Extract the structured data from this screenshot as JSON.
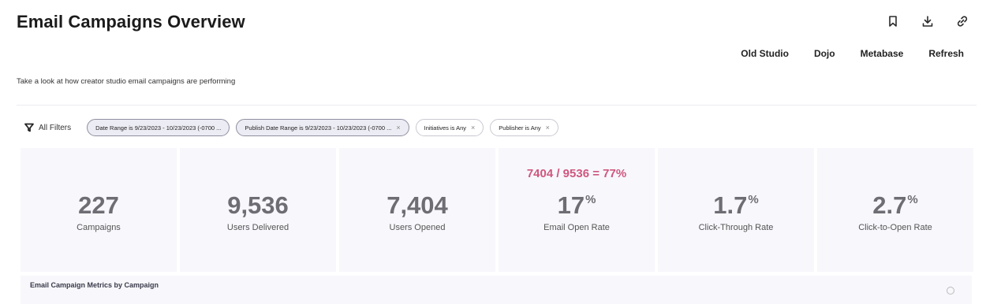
{
  "header": {
    "title": "Email Campaigns Overview",
    "subtitle": "Take a look at how creator studio email campaigns are performing",
    "icons": [
      "bookmark-icon",
      "download-icon",
      "link-icon"
    ],
    "nav_links": [
      "Old Studio",
      "Dojo",
      "Metabase",
      "Refresh"
    ]
  },
  "filters": {
    "all_filters_label": "All Filters",
    "chips": [
      {
        "label": "Date Range is 9/23/2023 - 10/23/2023 (-0700 ...",
        "removable": false,
        "active": true
      },
      {
        "label": "Publish Date Range is 9/23/2023 - 10/23/2023 (-0700 ...",
        "removable": true,
        "active": true
      },
      {
        "label": "Initiatives is Any",
        "removable": true,
        "active": false
      },
      {
        "label": "Publisher is Any",
        "removable": true,
        "active": false
      }
    ],
    "remove_glyph": "×"
  },
  "metrics": [
    {
      "value": "227",
      "suffix": "",
      "label": "Campaigns",
      "annotation": ""
    },
    {
      "value": "9,536",
      "suffix": "",
      "label": "Users Delivered",
      "annotation": ""
    },
    {
      "value": "7,404",
      "suffix": "",
      "label": "Users Opened",
      "annotation": ""
    },
    {
      "value": "17",
      "suffix": "%",
      "label": "Email Open Rate",
      "annotation": "7404 / 9536 = 77%"
    },
    {
      "value": "1.7",
      "suffix": "%",
      "label": "Click-Through Rate",
      "annotation": ""
    },
    {
      "value": "2.7",
      "suffix": "%",
      "label": "Click-to-Open Rate",
      "annotation": ""
    }
  ],
  "bottom_panel": {
    "title": "Email Campaign Metrics by Campaign"
  },
  "colors": {
    "annotation": "#d0567e",
    "card_bg": "#f7f7fc",
    "metric_value": "#6d6d73"
  }
}
